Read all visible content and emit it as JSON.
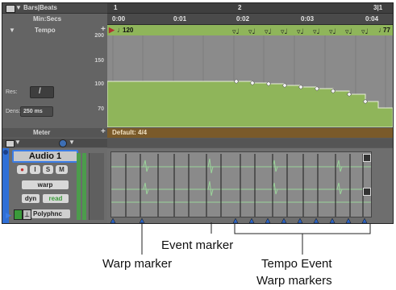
{
  "rulers": {
    "bars_beats": {
      "label": "Bars|Beats",
      "marks": [
        "1",
        "2",
        "3|1"
      ]
    },
    "min_secs": {
      "label": "Min:Secs",
      "marks": [
        "0:00",
        "0:01",
        "0:02",
        "0:03",
        "0:04"
      ]
    },
    "tempo": {
      "label": "Tempo",
      "first_event": "120",
      "last_event": "77",
      "scale": [
        "200",
        "150",
        "100",
        "70"
      ]
    },
    "meter": {
      "label": "Meter",
      "default": "Default: 4/4"
    }
  },
  "tempo_controls": {
    "res_label": "Res:",
    "dens_label": "Dens:",
    "dens_value": "250 ms"
  },
  "track": {
    "name": "Audio 1",
    "buttons": {
      "record": "●",
      "input": "I",
      "solo": "S",
      "mute": "M"
    },
    "view": "warp",
    "dyn": "dyn",
    "automation": "read",
    "plugin": "Polyphnc"
  },
  "callouts": {
    "event_marker": "Event marker",
    "warp_marker": "Warp marker",
    "tempo_event_line1": "Tempo Event",
    "tempo_event_line2": "Warp markers"
  },
  "colors": {
    "tempo_green": "#8fb55a",
    "meter_brown": "#7a5a2a",
    "track_blue": "#2f6fd6"
  }
}
